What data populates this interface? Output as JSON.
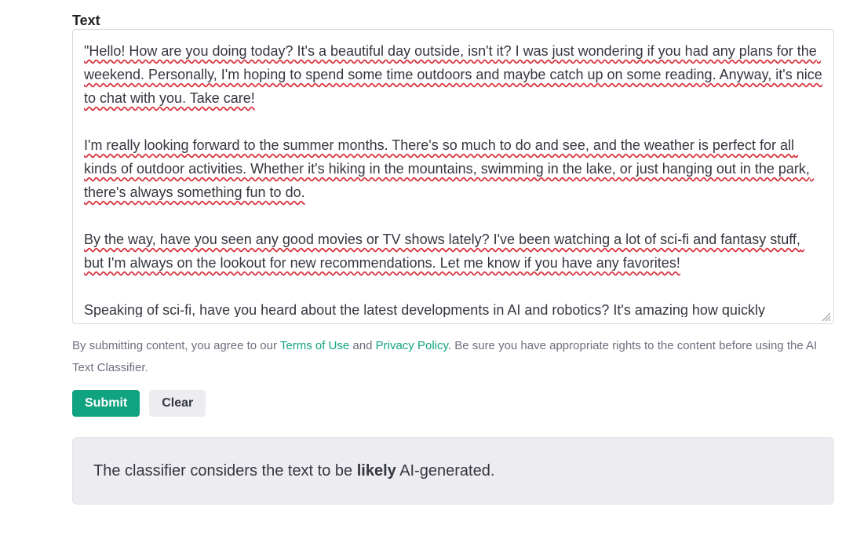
{
  "form": {
    "label": "Text",
    "textarea_value": "\"Hello! How are you doing today? It's a beautiful day outside, isn't it? I was just wondering if you had any plans for the weekend. Personally, I'm hoping to spend some time outdoors and maybe catch up on some reading. Anyway, it's nice to chat with you. Take care!\n\nI'm really looking forward to the summer months. There's so much to do and see, and the weather is perfect for all kinds of outdoor activities. Whether it's hiking in the mountains, swimming in the lake, or just hanging out in the park, there's always something fun to do.\n\nBy the way, have you seen any good movies or TV shows lately? I've been watching a lot of sci-fi and fantasy stuff, but I'm always on the lookout for new recommendations. Let me know if you have any favorites!\n\nSpeaking of sci-fi, have you heard about the latest developments in AI and robotics? It's amazing how quickly"
  },
  "disclaimer": {
    "pre": "By submitting content, you agree to our ",
    "terms": "Terms of Use",
    "and": " and ",
    "privacy": "Privacy Policy",
    "post": ". Be sure you have appropriate rights to the content before using the AI Text Classifier."
  },
  "buttons": {
    "submit": "Submit",
    "clear": "Clear"
  },
  "result": {
    "pre": "The classifier considers the text to be ",
    "bold": "likely",
    "post": " AI-generated."
  }
}
